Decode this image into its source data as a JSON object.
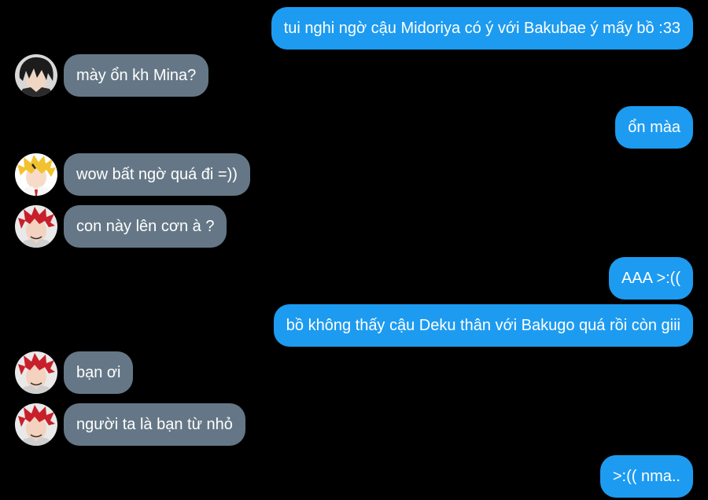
{
  "colors": {
    "background": "#000000",
    "sent_bubble": "#1d9bf0",
    "received_bubble": "#657786",
    "text": "#ffffff"
  },
  "messages": [
    {
      "side": "sent",
      "text": "tui nghi ngờ cậu Midoriya có ý với Bakubae ý mấy bồ :33"
    },
    {
      "side": "received",
      "avatar": "dark-hair-avatar",
      "text": "mày ổn kh Mina?"
    },
    {
      "side": "sent",
      "text": "ổn màa"
    },
    {
      "side": "received",
      "avatar": "blonde-hair-avatar",
      "text": "wow bất ngờ quá đi =))"
    },
    {
      "side": "received",
      "avatar": "red-hair-avatar",
      "text": "con này lên cơn à ?"
    },
    {
      "side": "sent",
      "text": "AAA >:(("
    },
    {
      "side": "sent",
      "text": "bồ không thấy cậu Deku thân với Bakugo quá rồi còn giii"
    },
    {
      "side": "received",
      "avatar": "red-hair-avatar",
      "text": "bạn ơi"
    },
    {
      "side": "received",
      "avatar": "red-hair-avatar",
      "text": "người ta là bạn từ nhỏ"
    },
    {
      "side": "sent",
      "text": ">:(( nma.."
    }
  ]
}
